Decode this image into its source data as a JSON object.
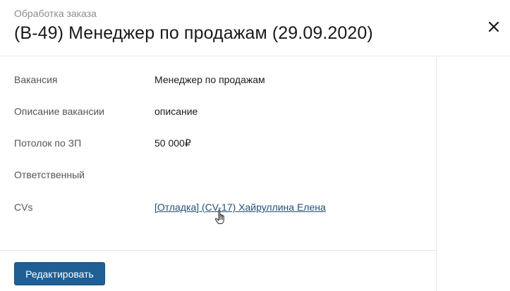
{
  "header": {
    "subtitle": "Обработка заказа",
    "title": "(В-49) Менеджер по продажам (29.09.2020)",
    "close_icon": "close-icon"
  },
  "fields": [
    {
      "label": "Вакансия",
      "value": "Менеджер по продажам"
    },
    {
      "label": "Описание вакансии",
      "value": "описание"
    },
    {
      "label": "Потолок по ЗП",
      "value": "50 000₽"
    },
    {
      "label": "Ответственный",
      "value": ""
    },
    {
      "label": "CVs",
      "value": "[Отладка] (CV-17) Хайруллина Елена",
      "is_link": true
    }
  ],
  "footer": {
    "edit_label": "Редактировать"
  },
  "colors": {
    "primary_button": "#1f5f95",
    "link": "#1f4f7a",
    "divider": "#e6e6e6"
  },
  "cursor_icon": "hand-pointer-icon"
}
